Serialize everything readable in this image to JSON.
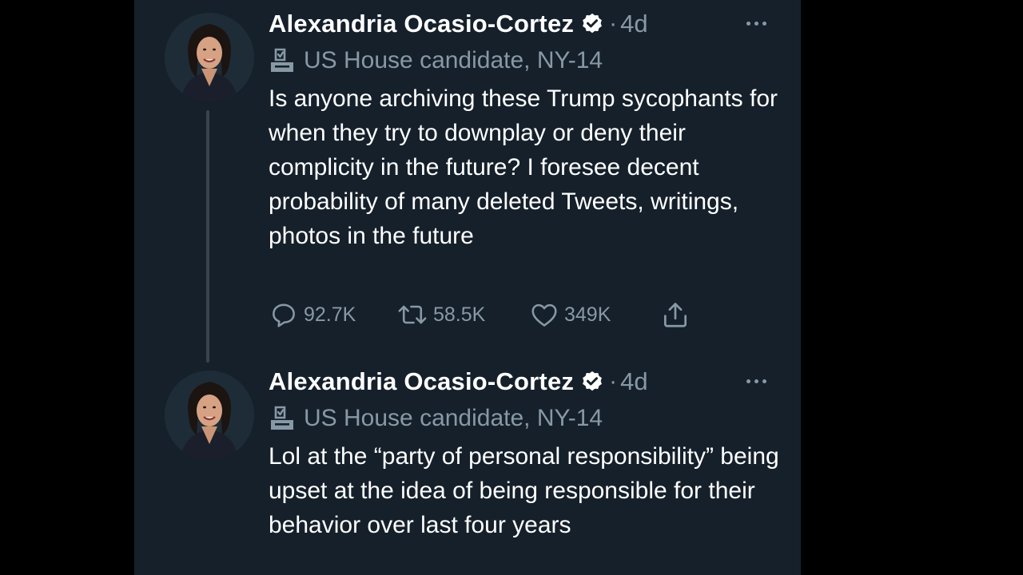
{
  "tweets": [
    {
      "author": {
        "display_name": "Alexandria Ocasio-Cortez",
        "verified": true,
        "label": "US House candidate, NY-14"
      },
      "time_separator": "·",
      "timestamp": "4d",
      "text": "Is anyone archiving these Trump sycophants for when they try to downplay or deny their complicity in the future? I foresee decent probability of many deleted Tweets, writings, photos in the future",
      "actions": {
        "reply_count": "92.7K",
        "retweet_count": "58.5K",
        "like_count": "349K"
      }
    },
    {
      "author": {
        "display_name": "Alexandria Ocasio-Cortez",
        "verified": true,
        "label": "US House candidate, NY-14"
      },
      "time_separator": "·",
      "timestamp": "4d",
      "text": "Lol at the “party of personal responsibility” being upset at the idea of being responsible for their behavior over last four years"
    }
  ],
  "icons": {
    "verified": "verified-badge-icon",
    "label": "ballot-box-icon",
    "more": "more-horizontal-icon",
    "reply": "reply-icon",
    "retweet": "retweet-icon",
    "like": "heart-icon",
    "share": "share-icon"
  },
  "colors": {
    "background": "#15202b",
    "outer_background": "#000000",
    "primary_text": "#ffffff",
    "secondary_text": "#8899a6",
    "thread_line": "#38444d"
  }
}
